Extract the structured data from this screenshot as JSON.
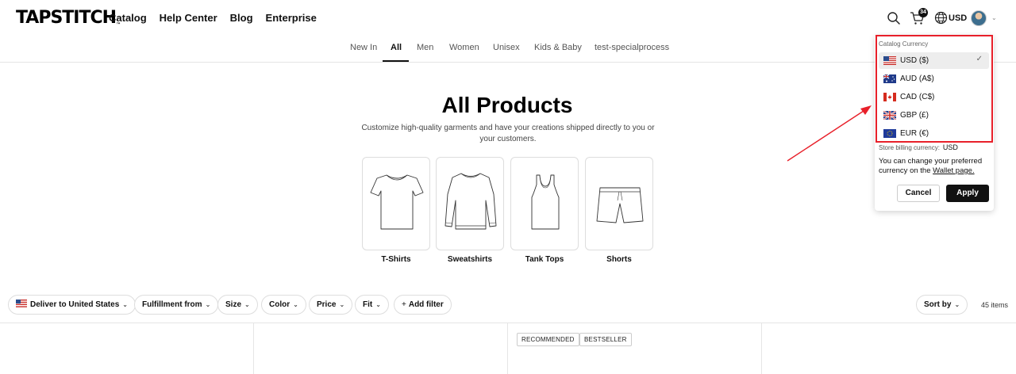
{
  "header": {
    "logo": "TAPSTITCH",
    "logo_tm": "™",
    "nav": [
      "Catalog",
      "Help Center",
      "Blog",
      "Enterprise"
    ],
    "cart_count": "34",
    "currency": "USD"
  },
  "category_tabs": [
    "New In",
    "All",
    "Men",
    "Women",
    "Unisex",
    "Kids & Baby",
    "test-specialprocess"
  ],
  "hero": {
    "title": "All Products",
    "subtitle": "Customize high-quality garments and have your creations shipped directly to you or your customers."
  },
  "categories": [
    "T-Shirts",
    "Sweatshirts",
    "Tank Tops",
    "Shorts"
  ],
  "filters": {
    "deliver": "Deliver to United States",
    "fulfillment": "Fulfillment from",
    "size": "Size",
    "color": "Color",
    "price": "Price",
    "fit": "Fit",
    "add_filter": "Add filter",
    "sort": "Sort by",
    "count": "45 items"
  },
  "tags": [
    "RECOMMENDED",
    "BESTSELLER"
  ],
  "currency_dropdown": {
    "title": "Catalog Currency",
    "options": [
      {
        "label": "USD ($)",
        "flag": "us-flag-icon",
        "selected": true
      },
      {
        "label": "AUD (A$)",
        "flag": "au-flag-icon",
        "selected": false
      },
      {
        "label": "CAD (C$)",
        "flag": "ca-flag-icon",
        "selected": false
      },
      {
        "label": "GBP (£)",
        "flag": "gb-flag-icon",
        "selected": false
      },
      {
        "label": "EUR (€)",
        "flag": "eu-flag-icon",
        "selected": false
      }
    ],
    "check": "✓",
    "billing_label": "Store billing currency:",
    "billing_value": "USD",
    "note_prefix": "You can change your preferred currency on the ",
    "note_link": "Wallet page.",
    "cancel": "Cancel",
    "apply": "Apply"
  },
  "colors": {
    "annotation": "#e8202a",
    "primary_button": "#111111"
  }
}
